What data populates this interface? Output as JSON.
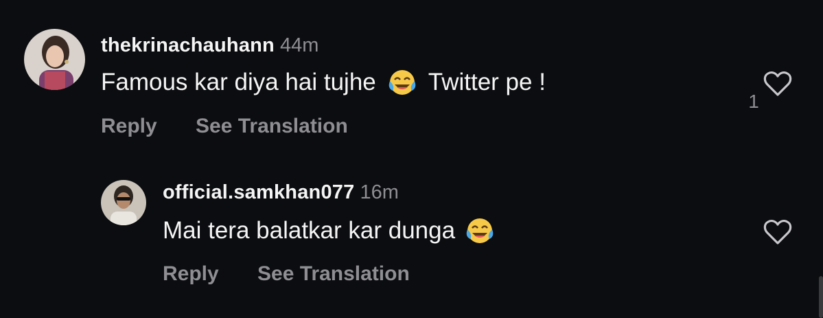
{
  "colors": {
    "background": "#0c0d10",
    "text_primary": "#f5f5f5",
    "text_secondary": "#8e8e93"
  },
  "comments": [
    {
      "username": "thekrinachauhann",
      "time": "44m",
      "text_before_emoji": "Famous kar diya hai tujhe",
      "emoji": "face-with-tears-of-joy",
      "text_after_emoji": "Twitter pe !",
      "reply_label": "Reply",
      "translate_label": "See Translation",
      "like_icon": "heart-outline-icon",
      "like_count": "1"
    },
    {
      "username": "official.samkhan077",
      "time": "16m",
      "text_before_emoji": "Mai tera balatkar kar dunga",
      "emoji": "face-with-tears-of-joy",
      "text_after_emoji": "",
      "reply_label": "Reply",
      "translate_label": "See Translation",
      "like_icon": "heart-outline-icon",
      "like_count": ""
    }
  ]
}
